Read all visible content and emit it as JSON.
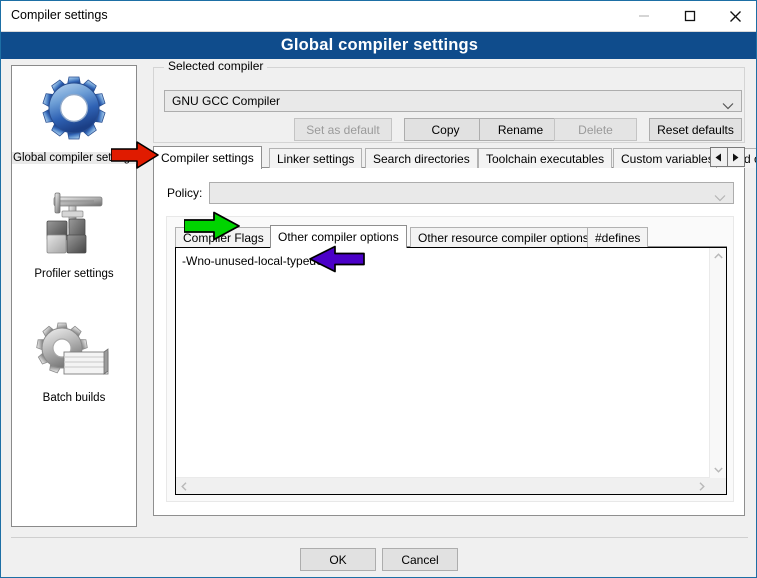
{
  "window": {
    "title": "Compiler settings",
    "controls": {
      "minimize": "minimize-icon",
      "maximize": "maximize-icon",
      "close": "close-icon"
    }
  },
  "header": {
    "title": "Global compiler settings",
    "background": "#0f4c8c",
    "text_color": "#ffffff"
  },
  "sidebar": {
    "items": [
      {
        "label": "Global compiler settings",
        "icon": "blue-gear-icon",
        "selected": true
      },
      {
        "label": "Profiler settings",
        "icon": "caliper-icon",
        "selected": false
      },
      {
        "label": "Batch builds",
        "icon": "gear-pages-icon",
        "selected": false
      }
    ]
  },
  "selected_compiler": {
    "caption": "Selected compiler",
    "combo_value": "GNU GCC Compiler",
    "buttons": [
      {
        "label": "Set as default",
        "disabled": true
      },
      {
        "label": "Copy",
        "disabled": false
      },
      {
        "label": "Rename",
        "disabled": false
      },
      {
        "label": "Delete",
        "disabled": true
      },
      {
        "label": "Reset defaults",
        "disabled": false
      }
    ]
  },
  "outer_tabs": {
    "items": [
      {
        "label": "Compiler settings",
        "selected": true
      },
      {
        "label": "Linker settings",
        "selected": false
      },
      {
        "label": "Search directories",
        "selected": false
      },
      {
        "label": "Toolchain executables",
        "selected": false
      },
      {
        "label": "Custom variables",
        "selected": false
      },
      {
        "label": "Build options",
        "selected": false
      }
    ],
    "scroll_left": "◀",
    "scroll_right": "▶"
  },
  "policy": {
    "label": "Policy:",
    "value": "",
    "placeholder": ""
  },
  "inner_tabs": {
    "items": [
      {
        "label": "Compiler Flags",
        "selected": false
      },
      {
        "label": "Other compiler options",
        "selected": true
      },
      {
        "label": "Other resource compiler options",
        "selected": false
      },
      {
        "label": "#defines",
        "selected": false
      }
    ]
  },
  "options_editor": {
    "value": "-Wno-unused-local-typedefs",
    "scrollbars": {
      "up": "scroll-up-icon",
      "down": "scroll-down-icon",
      "left": "scroll-left-icon",
      "right": "scroll-right-icon"
    }
  },
  "footer": {
    "ok_label": "OK",
    "cancel_label": "Cancel"
  },
  "annotations": [
    {
      "name": "red-arrow",
      "color": "#e01b00",
      "points_to": "Compiler settings tab",
      "direction": "right"
    },
    {
      "name": "green-arrow",
      "color": "#00d400",
      "points_to": "Other compiler options tab",
      "direction": "right"
    },
    {
      "name": "purple-arrow",
      "color": "#4b00c8",
      "points_to": "-Wno-unused-local-typedefs",
      "direction": "left"
    }
  ]
}
